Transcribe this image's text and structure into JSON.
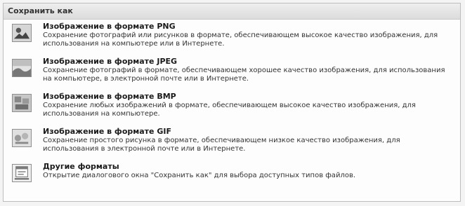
{
  "menu": {
    "title": "Сохранить как",
    "items": [
      {
        "icon": "png-image-icon",
        "title": "Изображение в формате PNG",
        "description": "Сохранение фотографий или рисунков в формате, обеспечивающем высокое качество изображения, для использования на компьютере или в Интернете."
      },
      {
        "icon": "jpeg-image-icon",
        "title": "Изображение в формате JPEG",
        "description": "Сохранение фотографий в формате, обеспечивающем хорошее качество изображения, для использования на компьютере, в электронной почте или в Интернете."
      },
      {
        "icon": "bmp-image-icon",
        "title": "Изображение в формате BMP",
        "description": "Сохранение любых изображений в формате, обеспечивающем высокое качество изображения, для использования на компьютере."
      },
      {
        "icon": "gif-image-icon",
        "title": "Изображение в формате GIF",
        "description": "Сохранение простого рисунка в формате, обеспечивающем низкое качество изображения, для использования в электронной почте или в Интернете."
      },
      {
        "icon": "other-formats-icon",
        "title": "Другие форматы",
        "description": "Открытие диалогового окна \"Сохранить как\" для выбора доступных типов файлов."
      }
    ]
  }
}
